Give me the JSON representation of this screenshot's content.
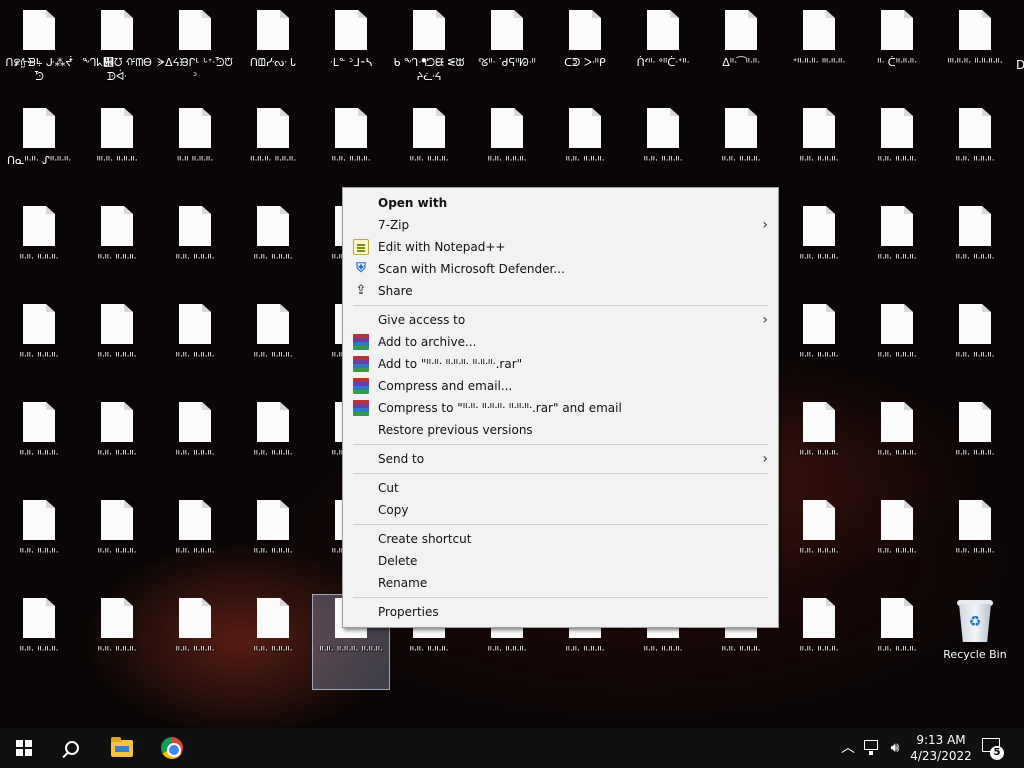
{
  "desktop": {
    "rows": [
      [
        "ᑎ꯹ᢔᙪꚥ ᒙ⁂ᖫᘬ",
        "ᙰᖾ᭎ᘮ ᡤᗰᎾᗬᐚ",
        "ᗔᐃᔦᙘᒋᒻ ᒡᐩᐧᘬᙈᐣ",
        "ᑎᗶᓹᔓᐧ Ꮣ",
        "ᐧᒪᓐ ᐣᒧ⁃ᓴ",
        "ᑲ ᙰᐧᖳᘤᙠ ᓬᙔᔨᓩᔦ",
        "ᓫᘜᐦᐧ ᐝᑯᕋᐦᘗᐧᐦ",
        "ᑕᕲ ᐳᐧᐦᑭ",
        "ᑏᔊᐦᐧ ᐤᐦᑖᐧᐩᐦᐧ",
        "ᐃᐦᐧ⁀ᐦᐧᐦᐧ",
        "ᐩᐦᐧᐦᐧᐦᐧ ᑊᐦᐧᐦᐧᐦᐧ",
        "ᐦᐧ ᑖᐦᐧᐦᐧᐦᐧ",
        "ᑊᐦᐧᐦᐧᐦᐧ ᐦᐧᐦᐧᐦᐧᐦᐧ"
      ],
      [
        "ᑎᓇᐦᐧᐦᐧ ᔑᐦᐧᐦᐧᐦᐧ",
        "ᑊᐦᐧᐦᐧ ᐦᐧᐦᐧᐦᐧ",
        "ᐦᐧᐦ ᐦᐧᐦᐧᐦᐧ",
        "ᐦᐧᐦᐧᐦᐧ ᐦᐧᐦᐧᐦᐧ",
        "ᐦᐧᐦᐧ ᐦᐧᐦᐧᐦᐧ",
        "ᐦᐧᐦᐧ ᐦᐧᐦᐧᐦᐧ",
        "ᐦᐧᐦᐧ ᐦᐧᐦᐧᐦᐧ",
        "ᐦᐧᐦᐧ ᐦᐧᐦᐧᐦᐧ",
        "ᐦᐧᐦᐧ ᐦᐧᐦᐧᐦᐧ",
        "ᐦᐧᐦᐧ ᐦᐧᐦᐧᐦᐧ",
        "ᐦᐧᐦᐧ ᐦᐧᐦᐧᐦᐧ",
        "ᐦᐧᐦᐧ ᐦᐧᐦᐧᐦᐧ",
        "ᐦᐧᐦᐧ ᐦᐧᐦᐧᐦᐧ"
      ],
      [
        "ᐦᐧᐦᐧ ᐦᐧᐦᐧᐦᐧ",
        "ᐦᐧᐦᐧ ᐦᐧᐦᐧᐦᐧ",
        "ᐦᐧᐦᐧ ᐦᐧᐦᐧᐦᐧ",
        "ᐦᐧᐦᐧ ᐦᐧᐦᐧᐦᐧ",
        "ᐦᐧᐦᐧ ᐦᐧᐦᐧᐦᐧ",
        "",
        "",
        "",
        "",
        "",
        "ᐦᐧᐦᐧ ᐦᐧᐦᐧᐦᐧ",
        "ᐦᐧᐦᐧ ᐦᐧᐦᐧᐦᐧ",
        "ᐦᐧᐦᐧ ᐦᐧᐦᐧᐦᐧ"
      ],
      [
        "ᐦᐧᐦᐧ ᐦᐧᐦᐧᐦᐧ",
        "ᐦᐧᐦᐧ ᐦᐧᐦᐧᐦᐧ",
        "ᐦᐧᐦᐧ ᐦᐧᐦᐧᐦᐧ",
        "ᐦᐧᐦᐧ ᐦᐧᐦᐧᐦᐧ",
        "ᐦᐧᐦᐧ ᐦᐧᐦᐧᐦᐧ",
        "",
        "",
        "",
        "",
        "",
        "ᐦᐧᐦᐧ ᐦᐧᐦᐧᐦᐧ",
        "ᐦᐧᐦᐧ ᐦᐧᐦᐧᐦᐧ",
        "ᐦᐧᐦᐧ ᐦᐧᐦᐧᐦᐧ"
      ],
      [
        "ᐦᐧᐦᐧ ᐦᐧᐦᐧᐦᐧ",
        "ᐦᐧᐦᐧ ᐦᐧᐦᐧᐦᐧ",
        "ᐦᐧᐦᐧ ᐦᐧᐦᐧᐦᐧ",
        "ᐦᐧᐦᐧ ᐦᐧᐦᐧᐦᐧ",
        "ᐦᐧᐦᐧ ᐦᐧᐦᐧᐦᐧ",
        "",
        "",
        "",
        "",
        "",
        "ᐦᐧᐦᐧ ᐦᐧᐦᐧᐦᐧ",
        "ᐦᐧᐦᐧ ᐦᐧᐦᐧᐦᐧ",
        "ᐦᐧᐦᐧ ᐦᐧᐦᐧᐦᐧ"
      ],
      [
        "ᐦᐧᐦᐧ ᐦᐧᐦᐧᐦᐧ",
        "ᐦᐧᐦᐧ ᐦᐧᐦᐧᐦᐧ",
        "ᐦᐧᐦᐧ ᐦᐧᐦᐧᐦᐧ",
        "ᐦᐧᐦᐧ ᐦᐧᐦᐧᐦᐧ",
        "ᐦᐧᐦᐧ ᐦᐧᐦᐧᐦᐧ",
        "",
        "",
        "",
        "",
        "",
        "ᐦᐧᐦᐧ ᐦᐧᐦᐧᐦᐧ",
        "ᐦᐧᐦᐧ ᐦᐧᐦᐧᐦᐧ",
        "ᐦᐧᐦᐧ ᐦᐧᐦᐧᐦᐧ"
      ],
      [
        "ᐦᐧᐦᐧ ᐦᐧᐦᐧᐦᐧ",
        "ᐦᐧᐦᐧ ᐦᐧᐦᐧᐦᐧ",
        "ᐦᐧᐦᐧ ᐦᐧᐦᐧᐦᐧ",
        "ᐦᐧᐦᐧ ᐦᐧᐦᐧᐦᐧ",
        "ᐦᐧᐦᐧ ᐦᐧᐦᐧᐦᐧ",
        "ᐦᐧᐦᐧ ᐦᐧᐦᐧᐦᐧ",
        "ᐦᐧᐦᐧ ᐦᐧᐦᐧᐦᐧ",
        "ᐦᐧᐦᐧ ᐦᐧᐦᐧᐦᐧ",
        "ᐦᐧᐦᐧ ᐦᐧᐦᐧᐦᐧ",
        "ᐦᐧᐦᐧ ᐦᐧᐦᐧᐦᐧ",
        "ᐦᐧᐦᐧ ᐦᐧᐦᐧᐦᐧ",
        "ᐦᐧᐦᐧ ᐦᐧᐦᐧᐦᐧ",
        "Recycle Bin"
      ]
    ],
    "selected_label": "ᐦᐧᐦᐧ ᐦᐧᐦᐧᐦᐧ ᐦᐧᐦᐧᐦᐧ",
    "recycle_bin_label": "Recycle Bin",
    "edge_label": "D"
  },
  "context_menu": {
    "items": [
      {
        "label": "Open with",
        "bold": true,
        "icon": "",
        "submenu": false
      },
      {
        "label": "7-Zip",
        "bold": false,
        "icon": "",
        "submenu": true
      },
      {
        "label": "Edit with Notepad++",
        "bold": false,
        "icon": "notepad-plus-plus-icon",
        "submenu": false
      },
      {
        "label": "Scan with Microsoft Defender...",
        "bold": false,
        "icon": "defender-shield-icon",
        "submenu": false
      },
      {
        "label": "Share",
        "bold": false,
        "icon": "share-icon",
        "submenu": false
      },
      {
        "separator": true
      },
      {
        "label": "Give access to",
        "bold": false,
        "icon": "",
        "submenu": true
      },
      {
        "label": "Add to archive...",
        "bold": false,
        "icon": "winrar-icon",
        "submenu": false
      },
      {
        "label": "Add to \"ᐦᐧᐦᐧ ᐦᐧᐦᐧᐦᐧ ᐦᐧᐦᐧᐦᐧ.rar\"",
        "bold": false,
        "icon": "winrar-icon",
        "submenu": false
      },
      {
        "label": "Compress and email...",
        "bold": false,
        "icon": "winrar-icon",
        "submenu": false
      },
      {
        "label": "Compress to \"ᐦᐧᐦᐧ ᐦᐧᐦᐧᐦᐧ ᐦᐧᐦᐧᐦᐧ.rar\" and email",
        "bold": false,
        "icon": "winrar-icon",
        "submenu": false
      },
      {
        "label": "Restore previous versions",
        "bold": false,
        "icon": "",
        "submenu": false
      },
      {
        "separator": true
      },
      {
        "label": "Send to",
        "bold": false,
        "icon": "",
        "submenu": true
      },
      {
        "separator": true
      },
      {
        "label": "Cut",
        "bold": false,
        "icon": "",
        "submenu": false
      },
      {
        "label": "Copy",
        "bold": false,
        "icon": "",
        "submenu": false
      },
      {
        "separator": true
      },
      {
        "label": "Create shortcut",
        "bold": false,
        "icon": "",
        "submenu": false
      },
      {
        "label": "Delete",
        "bold": false,
        "icon": "",
        "submenu": false
      },
      {
        "label": "Rename",
        "bold": false,
        "icon": "",
        "submenu": false
      },
      {
        "separator": true
      },
      {
        "label": "Properties",
        "bold": false,
        "icon": "",
        "submenu": false
      }
    ]
  },
  "taskbar": {
    "start_icon": "windows-logo-icon",
    "search_icon": "search-icon",
    "pinned": [
      "file-explorer-icon",
      "chrome-icon"
    ],
    "time": "9:13 AM",
    "date": "4/23/2022",
    "notification_count": "5"
  },
  "colors": {
    "menu_bg": "#f2f2f2",
    "taskbar_bg": "#101010",
    "selection": "#a0aac8"
  }
}
